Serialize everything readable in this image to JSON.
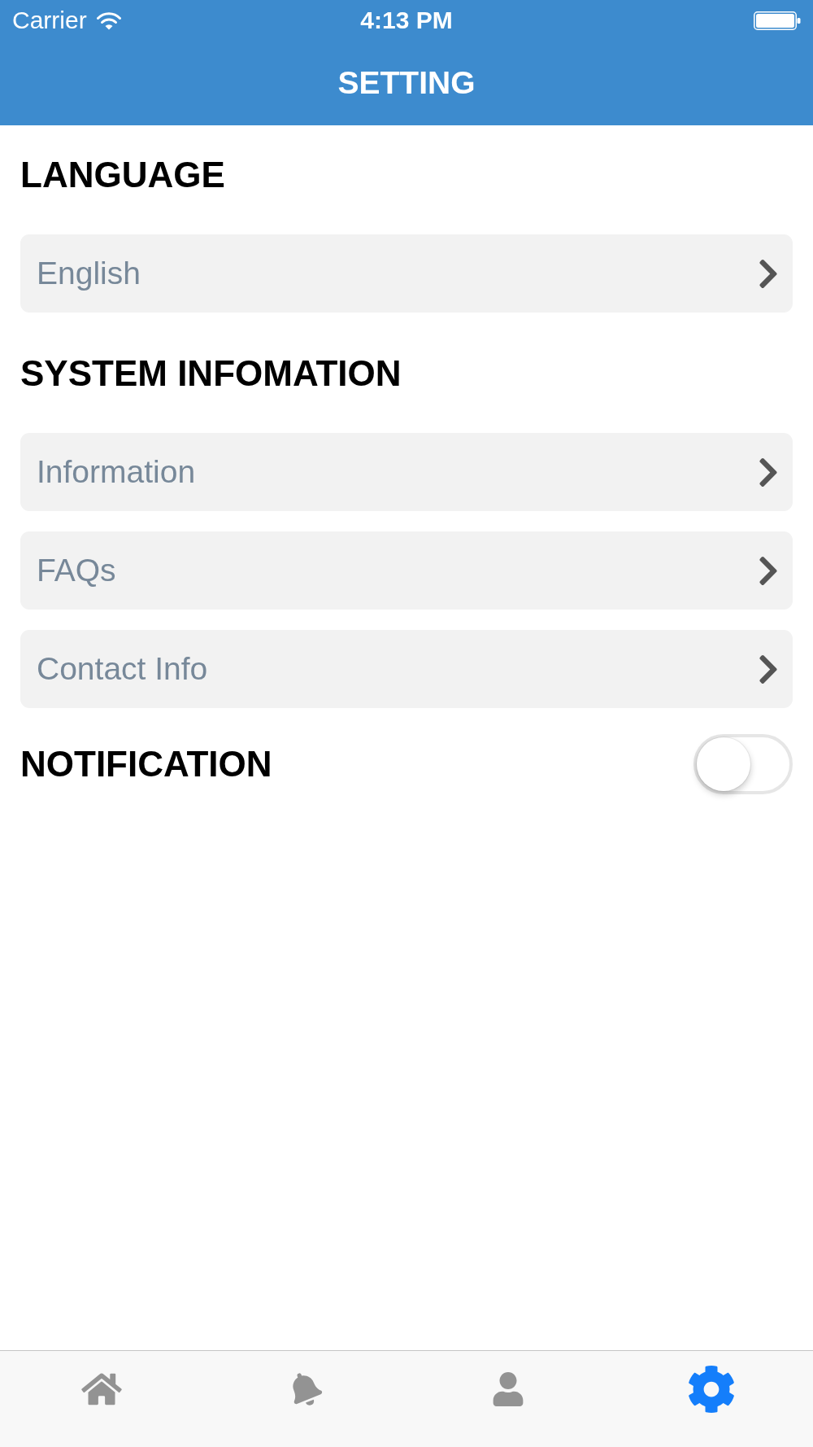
{
  "status_bar": {
    "carrier": "Carrier",
    "time": "4:13 PM"
  },
  "header": {
    "title": "SETTING"
  },
  "sections": [
    {
      "title": "LANGUAGE",
      "rows": [
        {
          "label": "English"
        }
      ]
    },
    {
      "title": "SYSTEM INFOMATION",
      "rows": [
        {
          "label": "Information"
        },
        {
          "label": "FAQs"
        },
        {
          "label": "Contact Info"
        }
      ]
    }
  ],
  "notification": {
    "label": "NOTIFICATION",
    "on": false
  },
  "tab_bar": {
    "items": [
      {
        "kind": "home",
        "selected": false
      },
      {
        "kind": "bell",
        "selected": false
      },
      {
        "kind": "person",
        "selected": false
      },
      {
        "kind": "gear",
        "selected": true
      }
    ]
  }
}
